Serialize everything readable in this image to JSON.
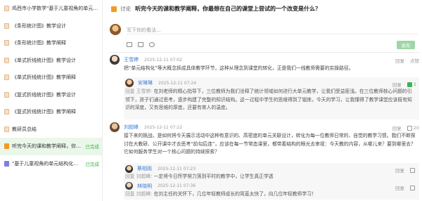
{
  "sidebar": {
    "items": [
      {
        "label": "鸡西市小学数学\"基于儿童视角的单元结构..."
      },
      {
        "label": "《条形统计图》教学设计"
      },
      {
        "label": "《条形统计图》教学阐释"
      },
      {
        "label": "《单式折线统计图》教学设计"
      },
      {
        "label": "《单式折线统计图》教学阐释"
      },
      {
        "label": "《复式折线统计图》教学设计"
      },
      {
        "label": "《复式折线统计图》教学阐释"
      },
      {
        "label": "教研员总结"
      },
      {
        "label": "听完今天的课和教学阐释，你最...",
        "tag": "已完成"
      },
      {
        "label": "\"基于儿童视角的单元结构化教学...",
        "tag": "已完成"
      }
    ]
  },
  "topic": {
    "label": "讨论",
    "text": "听完今天的课和教学阐释，你最想在自己的课堂上尝试的一个改变是什么？"
  },
  "composer": {
    "placeholder": "写下你的看法...",
    "send": "发布"
  },
  "comments": [
    {
      "name": "王雪婷",
      "time": "2025-12-11 07:02",
      "reply": "回复",
      "like": "点赞",
      "text": "把“单元结构化”等大概念拆成具体教学环节，这种从理念到课堂的转化，正是我们一线教师需要的实操路径。"
    },
    {
      "name": "安琳琳",
      "time": "2025-12-11 07:24",
      "reply": "回复",
      "like_count": "1",
      "prefix": "回复",
      "target": "王雪婷:",
      "text": "在刘老师的精心指导下，三位教师为我们诠释了统计领域如何进行大单元教学，让我们受益匪浅。在三位教师核心问题的引领下，孩子们通过思考，逐步构建了完整的知识结构。这一过程中学生的思维得到了锻炼，今天的学习，让我懂得了教学课堂应该既有知识的深度，又有思维的厚度，还要有育人的温度。"
    },
    {
      "name": "刘超峰",
      "time": "2025-12-11 07:22",
      "reply": "回复",
      "like_count": "20",
      "text": "接下来的挑战，是如何将今天展示活动中这种有意识的、高密度的单元关联设计，转化为每一位教师日常的、自觉的教学习惯。我们不断探讨在大教研、公开课中才去思考“前勾后连”，应该在每一节常态课里，都带着结构的眼光去审视：今天教的内容，从哪儿来？要到哪里去？它如何服务学生对一个核心问题的持续探索？"
    },
    {
      "name": "蔡相雨",
      "time": "2025-12-11 07:23",
      "reply": "回复",
      "prefix": "回复",
      "target": "刘超峰:",
      "text": "一定将今日所学努力落到平时的教学中，让学生真正学透"
    },
    {
      "name": "林晓明",
      "time": "2025-12-11 07:36",
      "reply": "回复",
      "prefix": "回复",
      "target": "刘超峰:",
      "text": "在刘主任的关怀下，几位年轻教师成长的简直太快了，向几位年轻教师学习！"
    }
  ]
}
